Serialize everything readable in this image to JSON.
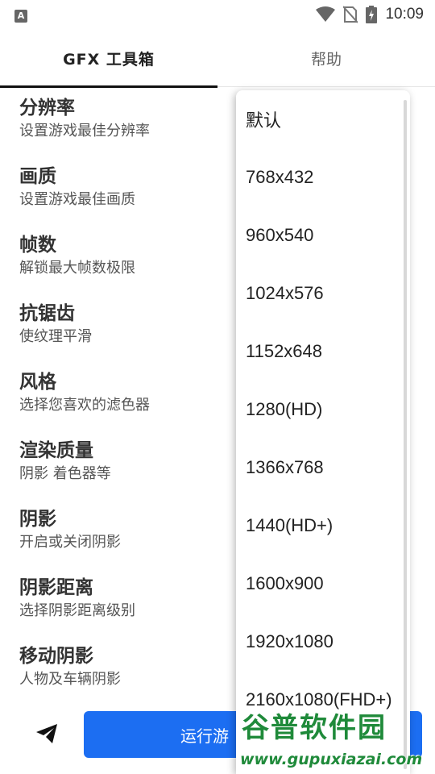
{
  "status_bar": {
    "left_icon": "A",
    "time": "10:09",
    "icons": [
      "wifi-icon",
      "no-sim-icon",
      "battery-charging-icon"
    ]
  },
  "tabs": [
    {
      "label": "GFX 工具箱",
      "active": true
    },
    {
      "label": "帮助",
      "active": false
    }
  ],
  "settings": [
    {
      "title": "分辨率",
      "subtitle": "设置游戏最佳分辨率"
    },
    {
      "title": "画质",
      "subtitle": "设置游戏最佳画质"
    },
    {
      "title": "帧数",
      "subtitle": "解锁最大帧数极限"
    },
    {
      "title": "抗锯齿",
      "subtitle": "使纹理平滑"
    },
    {
      "title": "风格",
      "subtitle": "选择您喜欢的滤色器"
    },
    {
      "title": "渲染质量",
      "subtitle": "阴影 着色器等"
    },
    {
      "title": "阴影",
      "subtitle": "开启或关闭阴影"
    },
    {
      "title": "阴影距离",
      "subtitle": "选择阴影距离级别"
    },
    {
      "title": "移动阴影",
      "subtitle": "人物及车辆阴影"
    }
  ],
  "dropdown": {
    "options": [
      "默认",
      "768x432",
      "960x540",
      "1024x576",
      "1152x648",
      "1280(HD)",
      "1366x768",
      "1440(HD+)",
      "1600x900",
      "1920x1080",
      "2160x1080(FHD+)"
    ]
  },
  "bottom": {
    "send_icon": "send-icon",
    "run_label": "运行游"
  },
  "watermark": {
    "title": "谷普软件园",
    "url": "www.gupuxiazai.com"
  },
  "colors": {
    "accent": "#1c6ef2",
    "watermark": "#1f8a3a"
  }
}
